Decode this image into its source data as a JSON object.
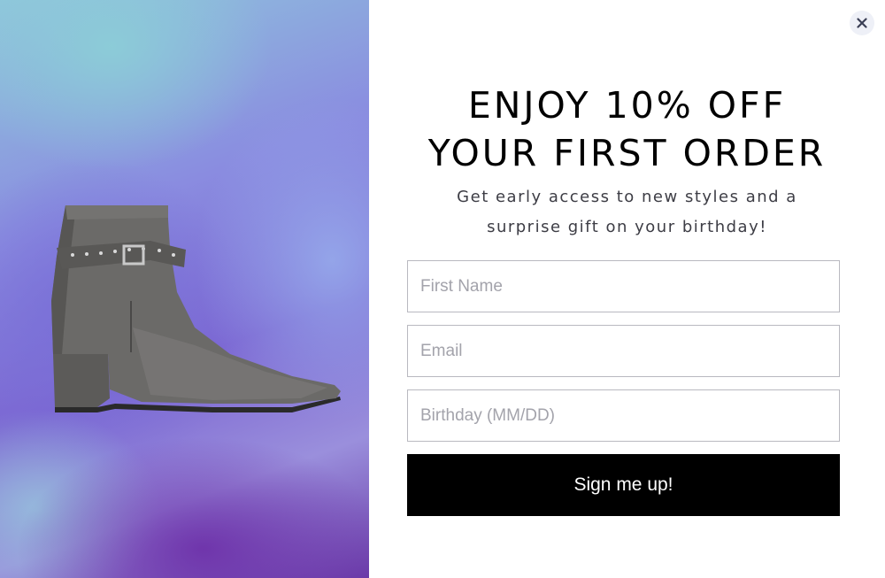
{
  "popup": {
    "headline_line1": "ENJOY 10% OFF",
    "headline_line2": "YOUR FIRST ORDER",
    "subtext_line1": "Get early access to new styles and a",
    "subtext_line2": "surprise gift on your birthday!",
    "fields": {
      "first_name_placeholder": "First Name",
      "email_placeholder": "Email",
      "birthday_placeholder": "Birthday (MM/DD)"
    },
    "submit_label": "Sign me up!",
    "close_glyph": "×"
  },
  "image": {
    "subject": "ankle-boot",
    "boot_color": "#6b6a68"
  },
  "colors": {
    "button_bg": "#000000",
    "button_text": "#ffffff",
    "border": "#b9b9c0",
    "close_bg": "#eef0f7"
  }
}
